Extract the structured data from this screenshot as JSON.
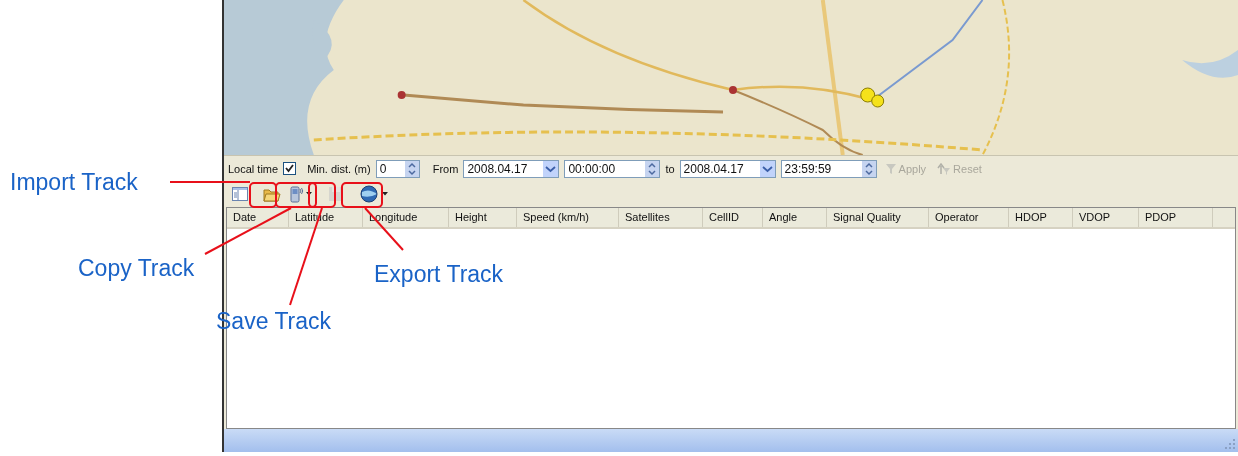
{
  "filter": {
    "local_time_label": "Local time",
    "local_time_checked": true,
    "min_dist_label": "Min. dist. (m)",
    "min_dist_value": "0",
    "from_label": "From",
    "from_date": "2008.04.17",
    "from_time": "00:00:00",
    "to_label": "to",
    "to_date": "2008.04.17",
    "to_time": "23:59:59",
    "actions": [
      {
        "kind": "apply",
        "label": "Apply",
        "disabled": true
      },
      {
        "kind": "reset",
        "label": "Reset",
        "disabled": true
      }
    ]
  },
  "toolbar": [
    {
      "kind": "layout",
      "disabled": false
    },
    {
      "kind": "open",
      "disabled": false
    },
    {
      "kind": "device",
      "disabled": false
    },
    {
      "kind": "save",
      "disabled": true
    },
    {
      "kind": "globe",
      "disabled": false
    }
  ],
  "table": {
    "columns": [
      "Date",
      "Latitude",
      "Longitude",
      "Height",
      "Speed (km/h)",
      "Satellites",
      "CellID",
      "Angle",
      "Signal Quality",
      "Operator",
      "HDOP",
      "VDOP",
      "PDOP"
    ]
  },
  "callouts": [
    {
      "text": "Import Track"
    },
    {
      "text": "Copy Track"
    },
    {
      "text": "Save Track"
    },
    {
      "text": "Export Track"
    }
  ]
}
